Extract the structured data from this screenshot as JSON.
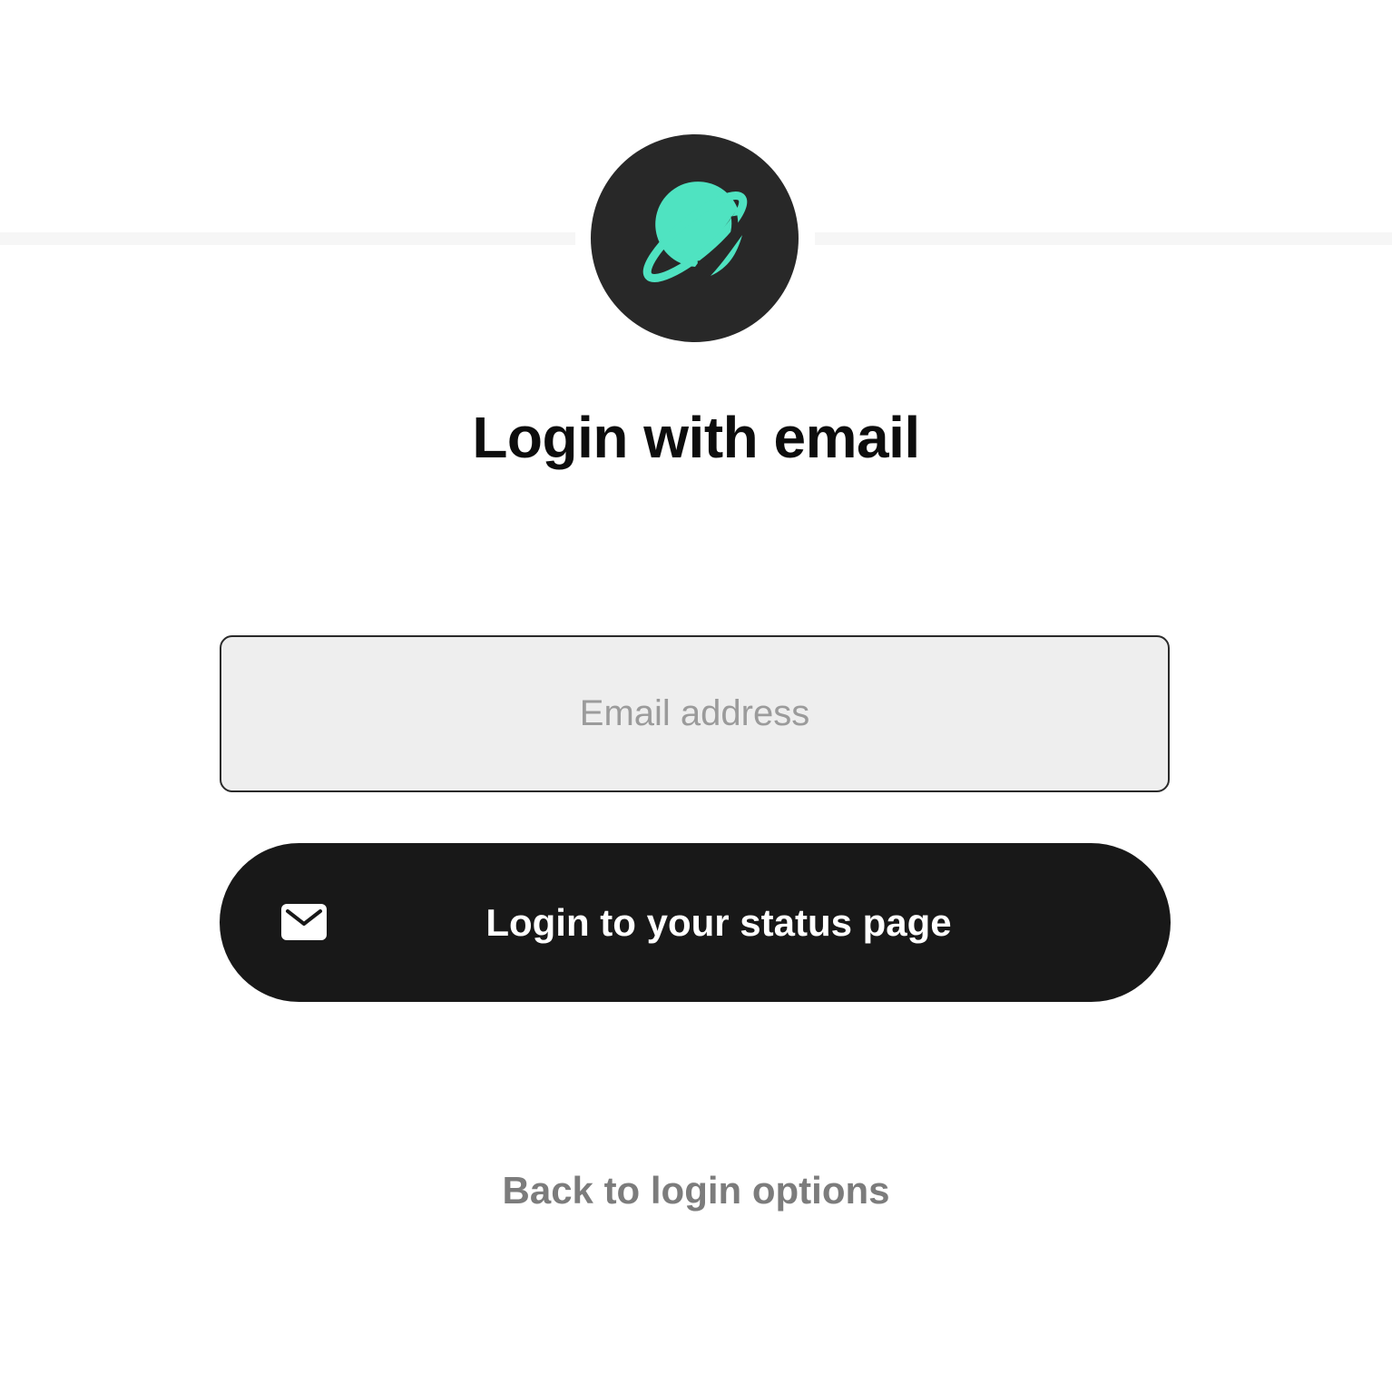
{
  "brand": {
    "logo_icon": "planet-icon",
    "accent_color": "#4fe3c1",
    "logo_background": "#282828"
  },
  "login": {
    "title": "Login with email",
    "email_placeholder": "Email address",
    "email_value": "",
    "submit_icon": "mail-icon",
    "submit_label": "Login to your status page",
    "back_link": "Back to login options"
  }
}
